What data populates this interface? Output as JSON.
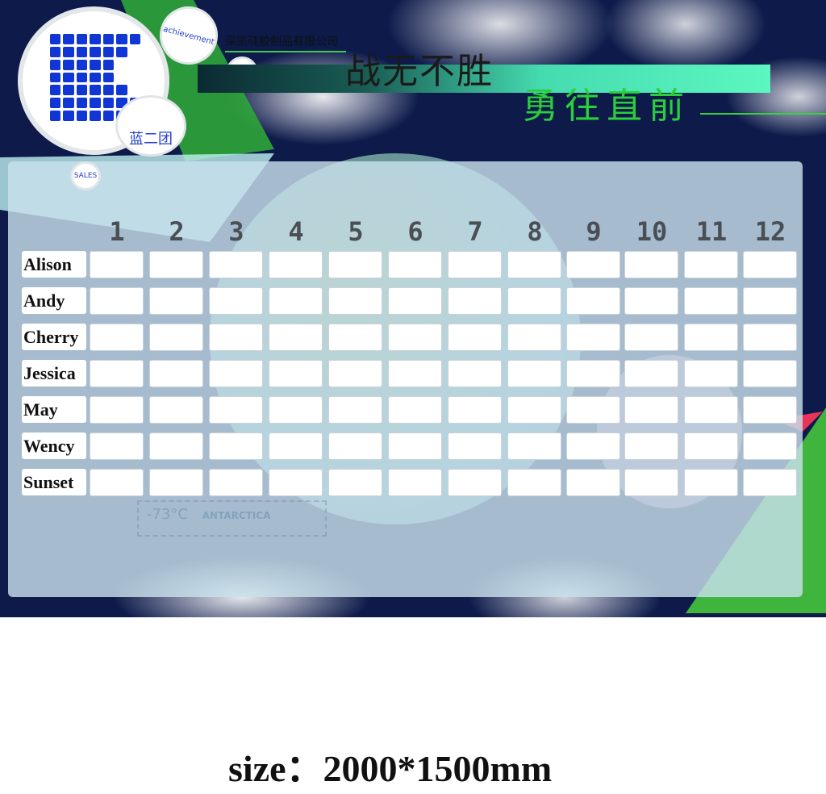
{
  "header": {
    "company": "深凯硅胶制品有限公司",
    "team": "蓝二团",
    "bubble_achievement": "achievement",
    "bubble_sales": "SALES",
    "slogan_1": "战无不胜",
    "slogan_2": "勇往直前"
  },
  "board": {
    "months": [
      "1",
      "2",
      "3",
      "4",
      "5",
      "6",
      "7",
      "8",
      "9",
      "10",
      "11",
      "12"
    ],
    "names": [
      "Alison",
      "Andy",
      "Cherry",
      "Jessica",
      "May",
      "Wency",
      "Sunset"
    ]
  },
  "background_text": {
    "stamp_temp": "-73°C",
    "stamp_place": "ANTARCTICA"
  },
  "footer": {
    "size": "size：2000*1500mm"
  },
  "colors": {
    "sky": "#0d1a4a",
    "logo_blue": "#1136d6",
    "accent_green": "#2bcf3a",
    "banner_teal": "#5cf7c0"
  }
}
